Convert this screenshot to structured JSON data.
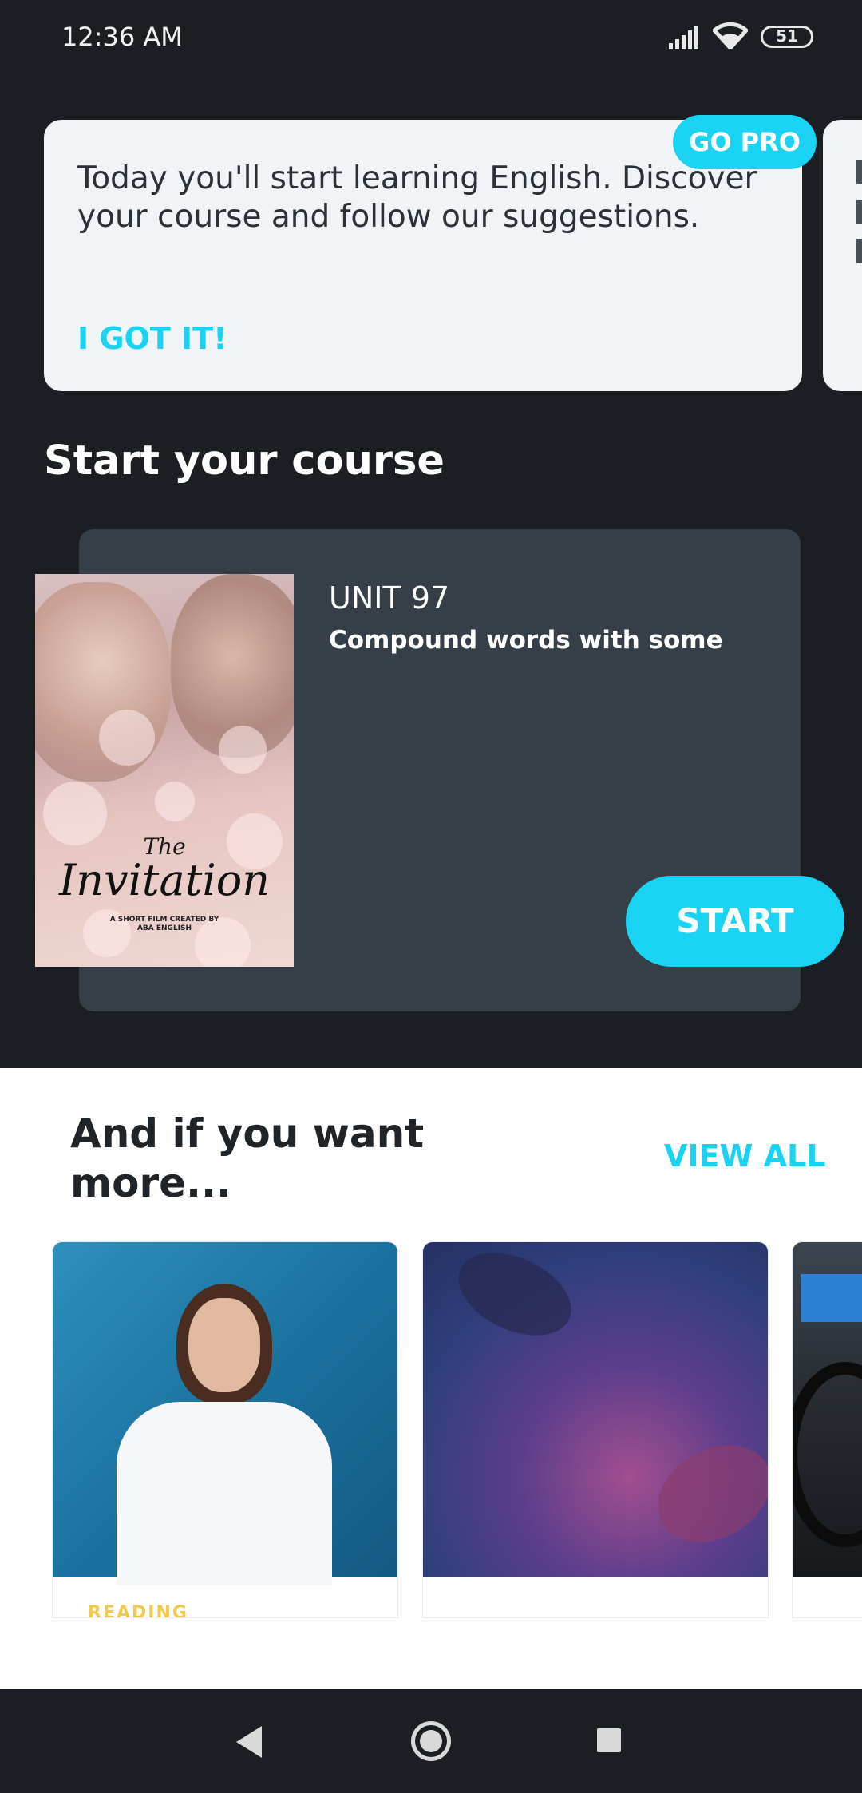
{
  "status_bar": {
    "time": "12:36 AM",
    "battery": "51"
  },
  "tip_card": {
    "text": "Today you'll start learning English. Discover your course and follow our suggestions.",
    "action": "I GOT IT!",
    "go_pro": "GO PRO"
  },
  "course_section": {
    "title": "Start your course",
    "poster": {
      "the": "The",
      "title": "Invitation",
      "subtitle_line1": "A SHORT FILM CREATED BY",
      "subtitle_line2": "ABA ENGLISH"
    },
    "unit_label": "UNIT 97",
    "unit_title": "Compound words with some",
    "start_button": "START"
  },
  "more_section": {
    "title": "And if you want more...",
    "view_all": "VIEW ALL",
    "thumb_tag": "READING"
  },
  "colors": {
    "accent": "#1ad3f2",
    "background": "#1b1e23",
    "card_dark": "#363f47",
    "tag_yellow": "#f3c94a"
  },
  "icons": [
    "signal-icon",
    "wifi-icon",
    "battery-icon",
    "back-icon",
    "home-icon",
    "recents-icon"
  ]
}
